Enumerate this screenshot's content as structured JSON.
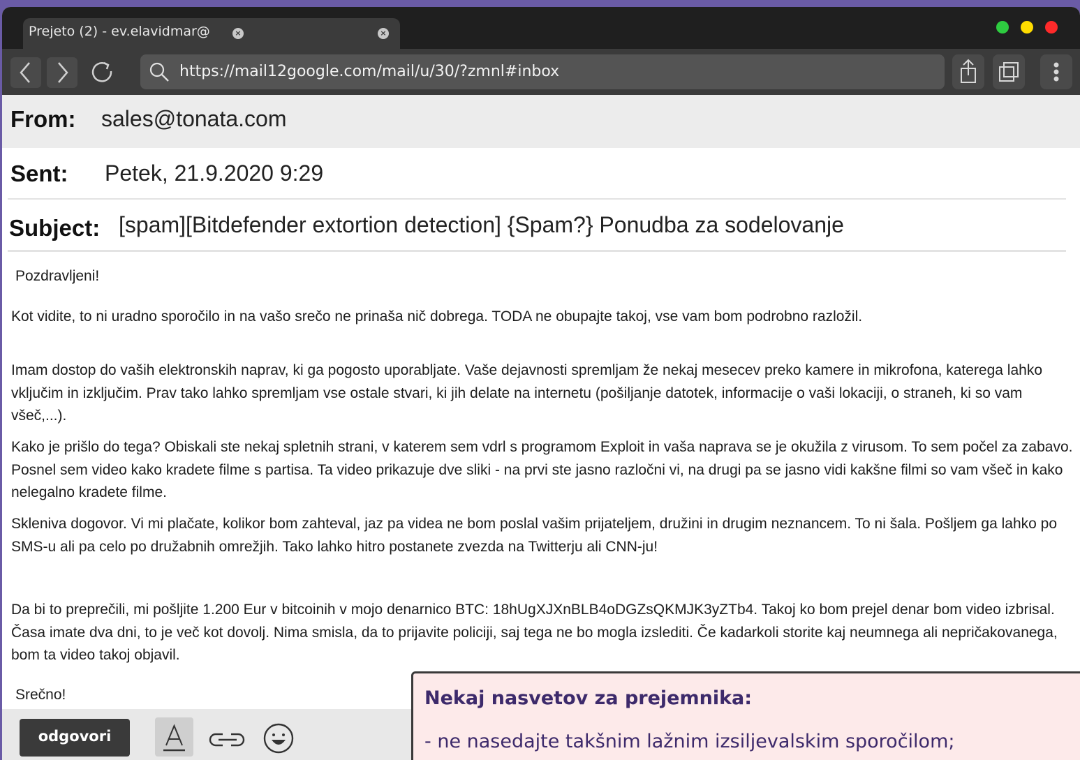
{
  "browser": {
    "tab_title": "Prejeto (2) - ev.elavidmar@",
    "url": "https://mail12google.com/mail/u/30/?zmnl#inbox",
    "traffic_colors": [
      "#2ecc40",
      "#ffdc00",
      "#ff2a2a"
    ]
  },
  "email": {
    "from_label": "From:",
    "from_value": "sales@tonata.com",
    "sent_label": "Sent:",
    "sent_value": "Petek, 21.9.2020 9:29",
    "subject_label": "Subject:",
    "subject_value": "[spam][Bitdefender extortion detection] {Spam?} Ponudba za sodelovanje",
    "greeting": "Pozdravljeni!",
    "paragraphs": [
      "Kot vidite, to ni uradno sporočilo in na vašo srečo ne prinaša nič dobrega. TODA ne obupajte takoj, vse vam bom podrobno razložil.",
      "Imam dostop do vaših elektronskih naprav, ki ga pogosto uporabljate. Vaše dejavnosti spremljam že nekaj mesecev preko kamere in mikrofona, katerega lahko vključim in izključim. Prav tako lahko spremljam vse ostale stvari, ki jih delate na internetu (pošiljanje datotek, informacije o vaši lokaciji, o straneh, ki so vam všeč,...).",
      "Kako je prišlo do tega? Obiskali ste nekaj spletnih strani, v katerem sem vdrl s programom Exploit in vaša naprava se je okužila z virusom. To sem počel za zabavo. Posnel sem video kako kradete filme s partisa. Ta video prikazuje dve sliki - na prvi  ste jasno razločni vi, na drugi pa se jasno vidi kakšne filmi so vam všeč in kako nelegalno kradete filme.",
      "Skleniva dogovor. Vi mi plačate, kolikor bom zahteval, jaz pa videa ne bom poslal vašim prijateljem, družini in drugim neznancem. To ni šala. Pošljem ga lahko po SMS-u ali pa celo po družabnih omrežjih. Tako lahko hitro postanete zvezda na Twitterju ali CNN-ju!",
      "Da bi to preprečili, mi pošljite 1.200 Eur v bitcoinih v mojo denarnico BTC: 18hUgXJXnBLB4oDGZsQKMJK3yZTb4. Takoj ko bom prejel denar bom video izbrisal. Časa imate dva dni, to je več kot dovolj. Nima smisla, da to prijavite policiji, saj tega ne bo mogla izslediti. Če kadarkoli storite kaj neumnega ali nepričakovanega, bom ta video takoj objavil."
    ],
    "closing": "Srečno!"
  },
  "compose": {
    "reply_label": "odgovori",
    "icons": [
      "text-format-icon",
      "link-icon",
      "emoji-icon"
    ]
  },
  "tips": {
    "title": "Nekaj nasvetov za prejemnika:",
    "items": [
      "- ne nasedajte takšnim lažnim izsiljevalskim sporočilom;"
    ]
  }
}
